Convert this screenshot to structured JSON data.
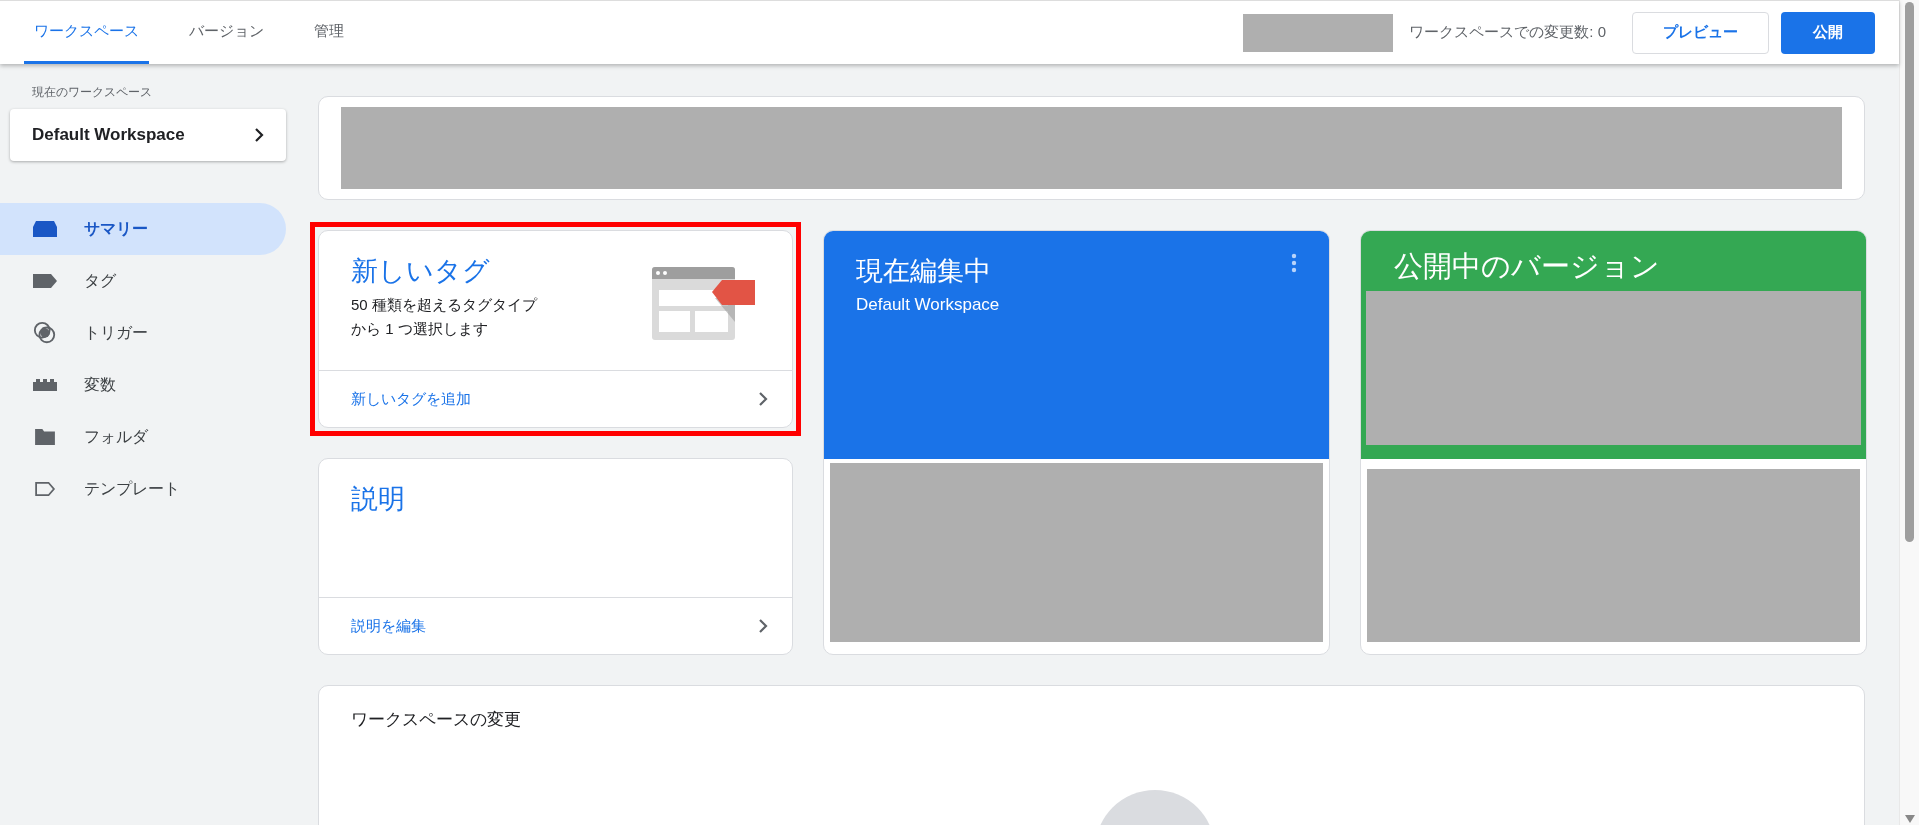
{
  "tabs": [
    {
      "label": "ワークスペース",
      "selected": true
    },
    {
      "label": "バージョン",
      "selected": false
    },
    {
      "label": "管理",
      "selected": false
    }
  ],
  "header": {
    "changes": "ワークスペースでの変更数: 0",
    "preview_button": "プレビュー",
    "publish_button": "公開"
  },
  "sidebar": {
    "workspace_label": "現在のワークスペース",
    "workspace": "Default Workspace",
    "items": [
      {
        "label": "サマリー",
        "kind": "summary",
        "selected": true
      },
      {
        "label": "タグ",
        "kind": "tag",
        "selected": false
      },
      {
        "label": "トリガー",
        "kind": "trigger",
        "selected": false
      },
      {
        "label": "変数",
        "kind": "variable",
        "selected": false
      },
      {
        "label": "フォルダ",
        "kind": "folder",
        "selected": false
      },
      {
        "label": "テンプレート",
        "kind": "template",
        "selected": false
      }
    ]
  },
  "new_tag_card": {
    "title": "新しいタグ",
    "description": "50 種類を超えるタグタイプから 1 つ選択します",
    "action": "新しいタグを追加",
    "highlighted": true
  },
  "editing_card": {
    "title": "現在編集中",
    "subtitle": "Default Workspace"
  },
  "published_card": {
    "title": "公開中のバージョン"
  },
  "description_card": {
    "title": "説明",
    "action": "説明を編集"
  },
  "changes_card": {
    "title": "ワークスペースの変更"
  }
}
